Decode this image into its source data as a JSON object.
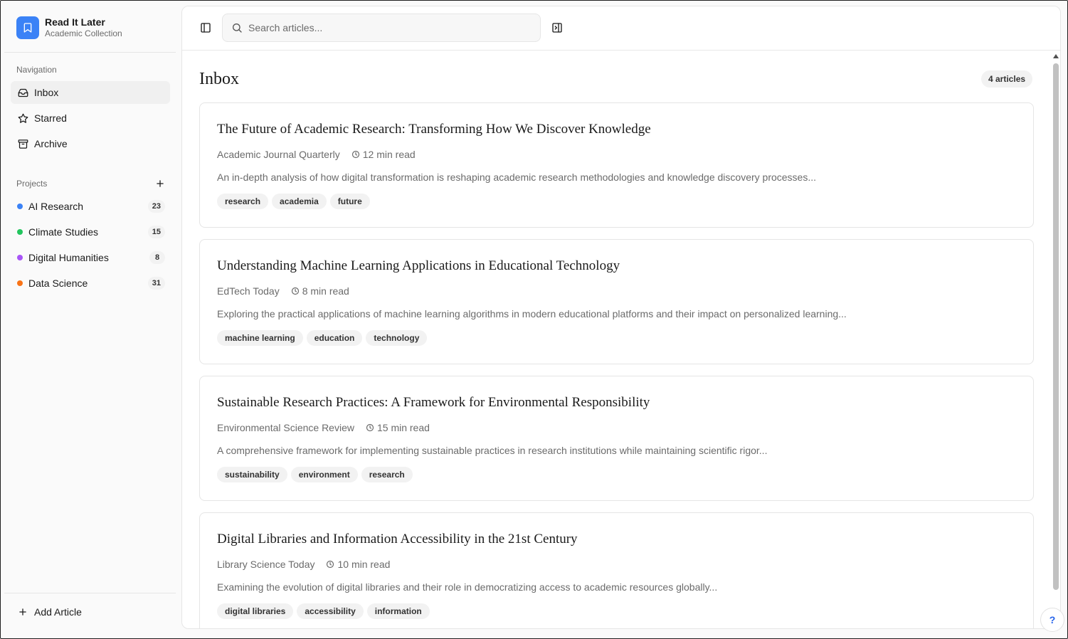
{
  "app": {
    "title": "Read It Later",
    "subtitle": "Academic Collection"
  },
  "sidebar": {
    "nav_label": "Navigation",
    "nav": [
      {
        "label": "Inbox",
        "icon": "inbox-icon",
        "active": true
      },
      {
        "label": "Starred",
        "icon": "star-icon"
      },
      {
        "label": "Archive",
        "icon": "archive-icon"
      }
    ],
    "projects_label": "Projects",
    "projects": [
      {
        "label": "AI Research",
        "count": "23",
        "color": "#3b82f6"
      },
      {
        "label": "Climate Studies",
        "count": "15",
        "color": "#22c55e"
      },
      {
        "label": "Digital Humanities",
        "count": "8",
        "color": "#a855f7"
      },
      {
        "label": "Data Science",
        "count": "31",
        "color": "#f97316"
      }
    ],
    "add_article": "Add Article"
  },
  "search": {
    "placeholder": "Search articles..."
  },
  "main": {
    "title": "Inbox",
    "count": "4 articles",
    "articles": [
      {
        "title": "The Future of Academic Research: Transforming How We Discover Knowledge",
        "source": "Academic Journal Quarterly",
        "read_time": "12 min read",
        "excerpt": "An in-depth analysis of how digital transformation is reshaping academic research methodologies and knowledge discovery processes...",
        "tags": [
          "research",
          "academia",
          "future"
        ]
      },
      {
        "title": "Understanding Machine Learning Applications in Educational Technology",
        "source": "EdTech Today",
        "read_time": "8 min read",
        "excerpt": "Exploring the practical applications of machine learning algorithms in modern educational platforms and their impact on personalized learning...",
        "tags": [
          "machine learning",
          "education",
          "technology"
        ]
      },
      {
        "title": "Sustainable Research Practices: A Framework for Environmental Responsibility",
        "source": "Environmental Science Review",
        "read_time": "15 min read",
        "excerpt": "A comprehensive framework for implementing sustainable practices in research institutions while maintaining scientific rigor...",
        "tags": [
          "sustainability",
          "environment",
          "research"
        ]
      },
      {
        "title": "Digital Libraries and Information Accessibility in the 21st Century",
        "source": "Library Science Today",
        "read_time": "10 min read",
        "excerpt": "Examining the evolution of digital libraries and their role in democratizing access to academic resources globally...",
        "tags": [
          "digital libraries",
          "accessibility",
          "information"
        ]
      }
    ]
  },
  "help": {
    "label": "?"
  }
}
